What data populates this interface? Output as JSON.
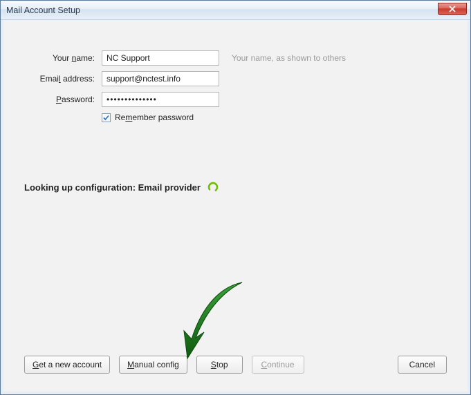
{
  "window": {
    "title": "Mail Account Setup"
  },
  "form": {
    "name_label_pre": "Your ",
    "name_label_u": "n",
    "name_label_post": "ame:",
    "name_value": "NC Support",
    "name_hint": "Your name, as shown to others",
    "email_label_pre": "Emai",
    "email_label_u": "l",
    "email_label_post": " address:",
    "email_value": "support@nctest.info",
    "password_label_u": "P",
    "password_label_post": "assword:",
    "password_value": "••••••••••••••",
    "remember_checked": true,
    "remember_pre": "Re",
    "remember_u": "m",
    "remember_post": "ember password"
  },
  "status": {
    "text": "Looking up configuration: Email provider"
  },
  "buttons": {
    "new_account_u": "G",
    "new_account_post": "et a new account",
    "manual_u": "M",
    "manual_post": "anual config",
    "stop_u": "S",
    "stop_post": "top",
    "continue": "Continue",
    "cancel": "Cancel"
  },
  "colors": {
    "spinner": "#6fbf00",
    "arrow": "#1a7a1a"
  }
}
